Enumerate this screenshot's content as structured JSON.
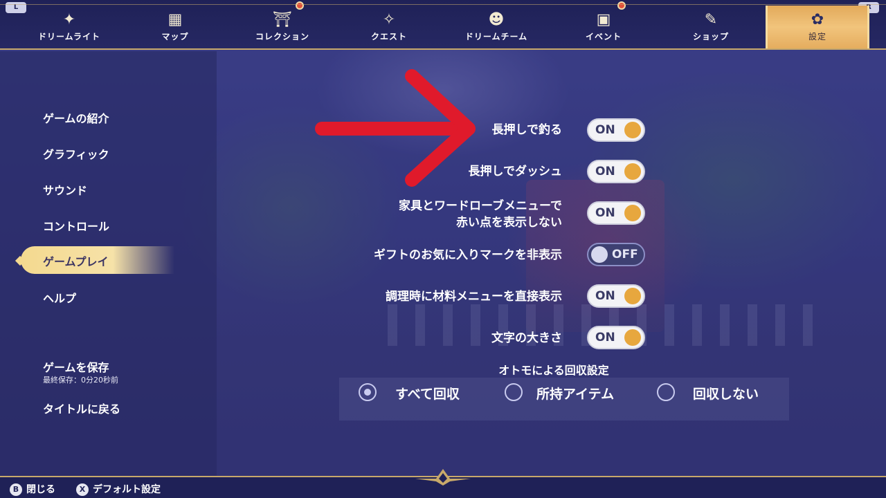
{
  "topbar": {
    "shoulder_left": "L",
    "shoulder_right": "R",
    "tabs": [
      {
        "label": "ドリームライト",
        "icon": "dreamlight-sparkle-icon",
        "glyph": "✦"
      },
      {
        "label": "マップ",
        "icon": "map-icon",
        "glyph": "▦"
      },
      {
        "label": "コレクション",
        "icon": "collection-pillar-icon",
        "glyph": "⛩"
      },
      {
        "label": "クエスト",
        "icon": "quest-star-icon",
        "glyph": "✧"
      },
      {
        "label": "ドリームチーム",
        "icon": "team-people-icon",
        "glyph": "☻"
      },
      {
        "label": "イベント",
        "icon": "event-calendar-icon",
        "glyph": "▣"
      },
      {
        "label": "ショップ",
        "icon": "shop-tag-icon",
        "glyph": "✎"
      },
      {
        "label": "設定",
        "icon": "settings-gear-icon",
        "glyph": "✿"
      }
    ]
  },
  "sidebar": {
    "items": [
      "ゲームの紹介",
      "グラフィック",
      "サウンド",
      "コントロール",
      "ゲームプレイ",
      "ヘルプ"
    ],
    "active_item": "ゲームプレイ",
    "save_game": "ゲームを保存",
    "last_saved": "最終保存：0分20秒前",
    "back_to_title": "タイトルに戻る"
  },
  "settings": [
    {
      "label": "長押しで釣る",
      "state": "ON",
      "on": true
    },
    {
      "label": "長押しでダッシュ",
      "state": "ON",
      "on": true
    },
    {
      "label_line1": "家具とワードローブメニューで",
      "label_line2": "赤い点を表示しない",
      "state": "ON",
      "on": true
    },
    {
      "label": "ギフトのお気に入りマークを非表示",
      "state": "OFF",
      "on": false
    },
    {
      "label": "調理時に材料メニューを直接表示",
      "state": "ON",
      "on": true
    },
    {
      "label": "文字の大きさ",
      "state": "ON",
      "on": true
    }
  ],
  "recovery": {
    "title": "オトモによる回収設定",
    "options": [
      "すべて回収",
      "所持アイテム",
      "回収しない"
    ],
    "selected": "すべて回収"
  },
  "bottombar": {
    "close_button": "B",
    "close_label": "閉じる",
    "default_button": "X",
    "default_label": "デフォルト設定"
  },
  "colors": {
    "accent_gold": "#c8a96a",
    "toggle_knob_on": "#e7a73e",
    "arrow_red": "#e01a2b",
    "notification_dot": "#e0503a"
  }
}
